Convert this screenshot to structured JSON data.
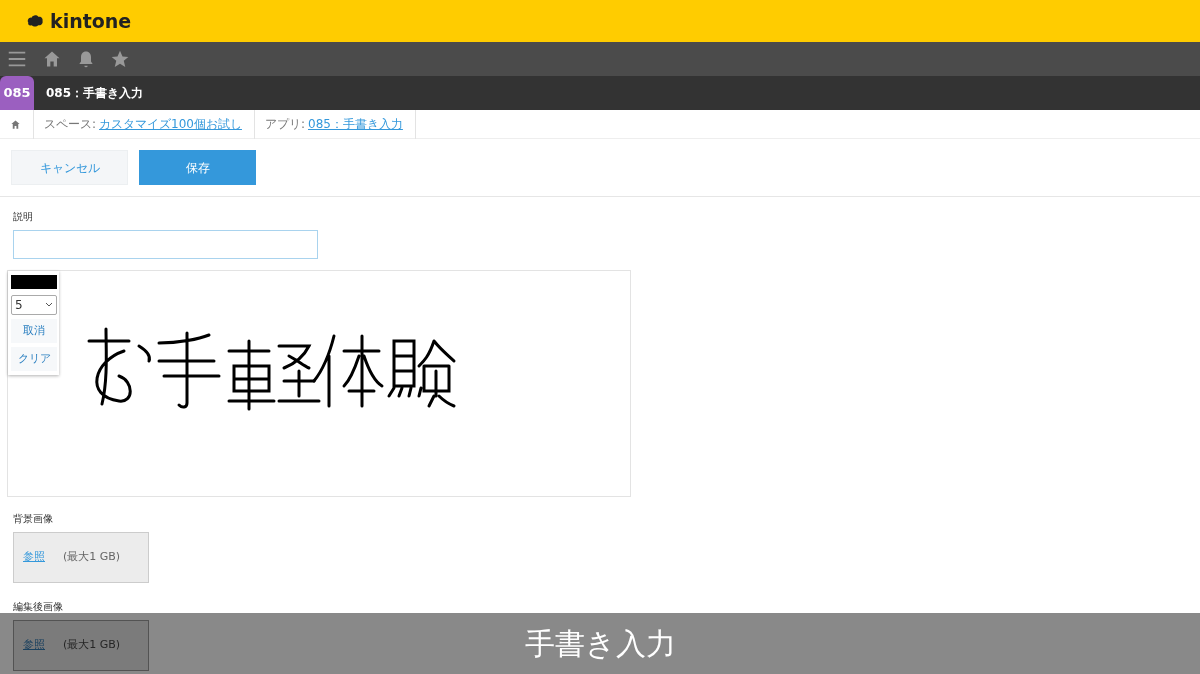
{
  "header": {
    "logo": "kintone"
  },
  "app": {
    "badge": "085",
    "title": "085：手書き入力"
  },
  "breadcrumb": [
    {
      "label": "スペース:",
      "link": "カスタマイズ100個お試し"
    },
    {
      "label": "アプリ:",
      "link": "085：手書き入力"
    }
  ],
  "buttons": [
    {
      "label": "キャンセル",
      "kind": "secondary"
    },
    {
      "label": "保存",
      "kind": "primary"
    }
  ],
  "fields": [
    {
      "kind": "text",
      "label": "説明"
    },
    {
      "kind": "handwriting",
      "pen_size": "5",
      "tools": [
        "取消",
        "クリア"
      ]
    },
    {
      "kind": "file",
      "label": "背景画像",
      "browse": "参照",
      "limit": "(最大1 GB)"
    },
    {
      "kind": "file",
      "label": "編集後画像",
      "browse": "参照",
      "limit": "(最大1 GB)"
    }
  ],
  "caption": "手書き入力"
}
